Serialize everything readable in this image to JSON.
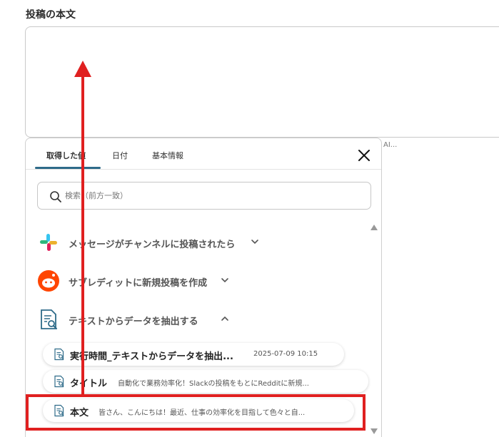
{
  "field": {
    "label": "投稿の本文",
    "hint": "AI..."
  },
  "panel": {
    "tabs": [
      {
        "label": "取得した値",
        "active": true
      },
      {
        "label": "日付",
        "active": false
      },
      {
        "label": "基本情報",
        "active": false
      }
    ],
    "search": {
      "placeholder": "検索（前方一致）"
    },
    "sections": [
      {
        "label": "メッセージがチャンネルに投稿されたら",
        "icon": "slack-icon",
        "expanded": false
      },
      {
        "label": "サブレディットに新規投稿を作成",
        "icon": "reddit-icon",
        "expanded": false
      },
      {
        "label": "テキストからデータを抽出する",
        "icon": "document-search-icon",
        "expanded": true
      }
    ],
    "items": [
      {
        "title": "実行時間_テキストからデータを抽出...",
        "value": "2025-07-09 10:15"
      },
      {
        "title": "タイトル",
        "value": "自動化で業務効率化！Slackの投稿をもとにRedditに新規..."
      },
      {
        "title": "本文",
        "value": "皆さん、こんにちは！最近、仕事の効率化を目指して色々と自..."
      }
    ]
  },
  "colors": {
    "annotation": "#e02020",
    "tab_accent": "#2e6b89"
  }
}
